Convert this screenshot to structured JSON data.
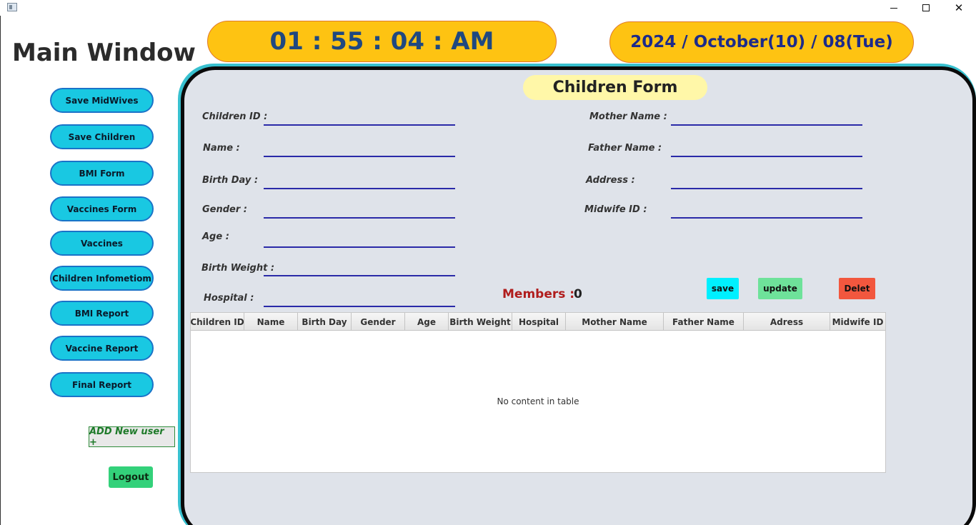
{
  "window": {
    "title_icon": "app-window-icon",
    "minimize_icon": "minimize-icon",
    "maximize_icon": "maximize-icon",
    "close_glyph": "✕"
  },
  "app": {
    "title": "Main Window"
  },
  "header": {
    "clock": "01 : 55 : 04 : AM",
    "date": "2024 / October(10) / 08(Tue)"
  },
  "sidebar": {
    "items": [
      {
        "label": "Save MidWives"
      },
      {
        "label": "Save Children"
      },
      {
        "label": "BMI Form"
      },
      {
        "label": "Vaccines Form"
      },
      {
        "label": "Vaccines"
      },
      {
        "label": "Children Infometiom"
      },
      {
        "label": "BMI Report"
      },
      {
        "label": "Vaccine Report"
      },
      {
        "label": "Final Report"
      }
    ],
    "add_user": "ADD New user +",
    "logout": "Logout"
  },
  "form": {
    "title": "Children Form",
    "fields": {
      "children_id": {
        "label": "Children ID :",
        "value": ""
      },
      "name": {
        "label": "Name  :",
        "value": ""
      },
      "birth_day": {
        "label": "Birth Day :",
        "value": ""
      },
      "gender": {
        "label": "Gender :",
        "value": ""
      },
      "age": {
        "label": "Age :",
        "value": ""
      },
      "birth_weight": {
        "label": "Birth Weight :",
        "value": ""
      },
      "hospital": {
        "label": "Hospital :",
        "value": ""
      },
      "mother_name": {
        "label": "Mother Name :",
        "value": ""
      },
      "father_name": {
        "label": "Father Name :",
        "value": ""
      },
      "address": {
        "label": "Address :",
        "value": ""
      },
      "midwife_id": {
        "label": "Midwife ID :",
        "value": ""
      }
    },
    "members_label": "Members :",
    "members_count": "0",
    "buttons": {
      "save": "save",
      "update": "update",
      "delete": "Delet"
    }
  },
  "table": {
    "columns": [
      "Children ID",
      "Name",
      "Birth Day",
      "Gender",
      "Age",
      "Birth Weight",
      "Hospital",
      "Mother Name",
      "Father Name",
      "Adress",
      "Midwife ID"
    ],
    "rows": [],
    "empty_message": "No content in table"
  }
}
